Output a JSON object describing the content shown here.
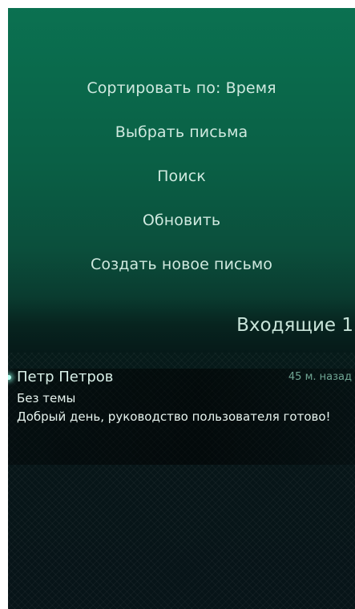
{
  "pulley_menu": {
    "items": [
      {
        "label": "Сортировать по: Время"
      },
      {
        "label": "Выбрать письма"
      },
      {
        "label": "Поиск"
      },
      {
        "label": "Обновить"
      },
      {
        "label": "Создать новое письмо"
      }
    ]
  },
  "header": {
    "title": "Входящие 1"
  },
  "messages": [
    {
      "sender": "Петр Петров",
      "time": "45 м. назад",
      "subject": "Без темы",
      "preview": "Добрый день, руководство пользователя готово!",
      "unread": true
    }
  ],
  "colors": {
    "accent_glow": "#b8fff0",
    "background_top": "#0b7151",
    "background_bottom": "#071418"
  }
}
